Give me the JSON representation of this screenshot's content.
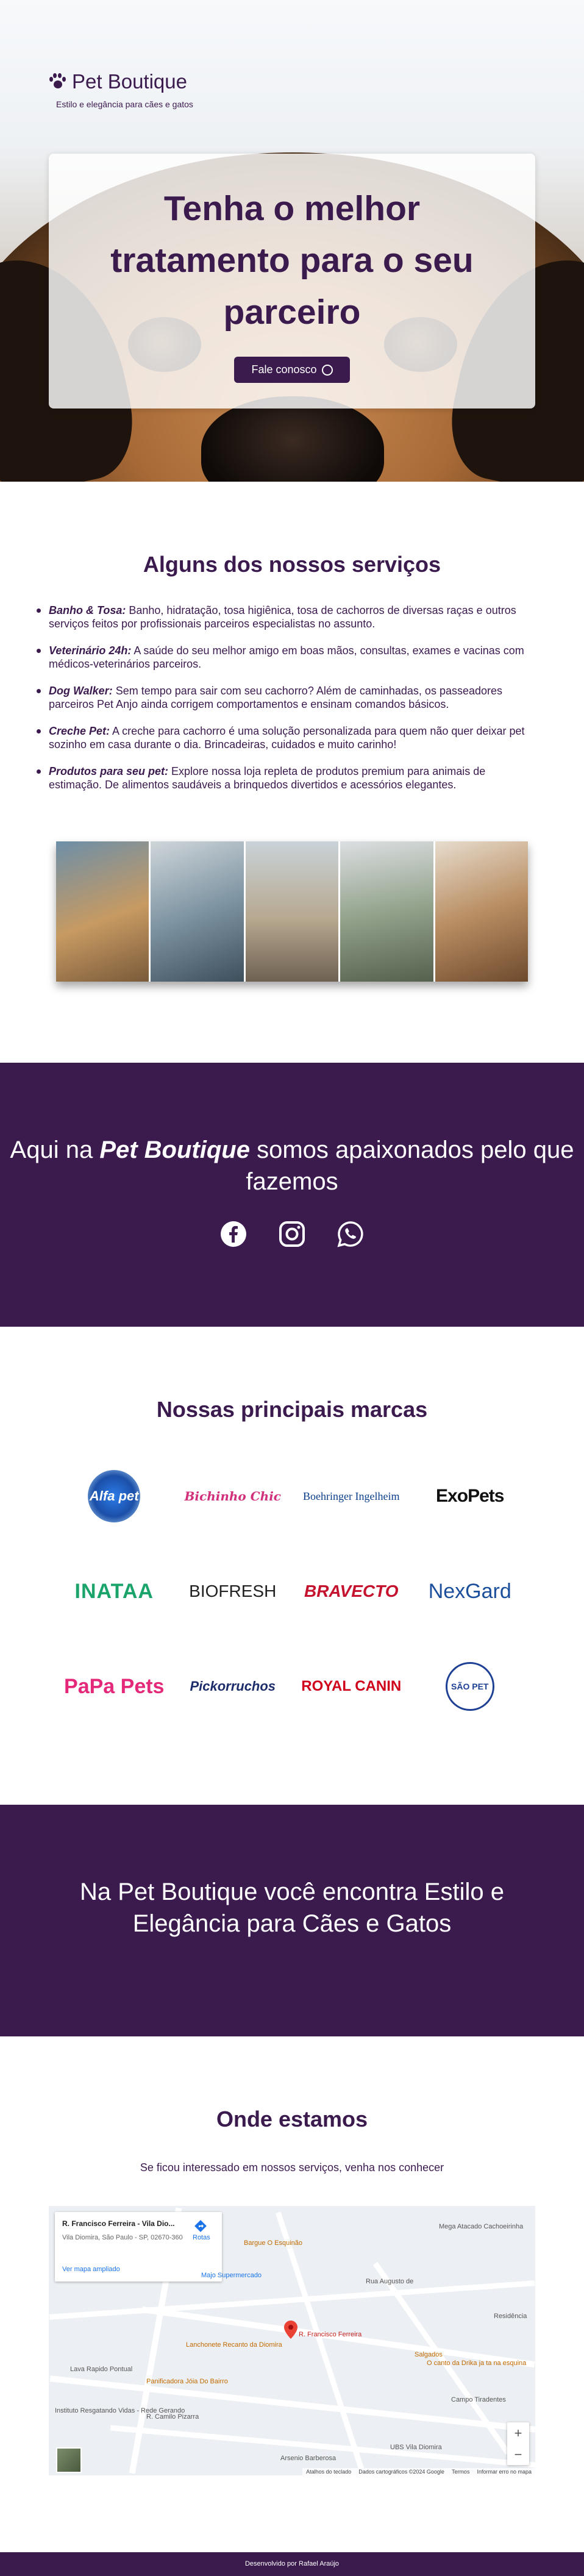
{
  "header": {
    "brand_name": "Pet Boutique",
    "tagline": "Estilo e elegância para cães e gatos"
  },
  "hero": {
    "title": "Tenha o melhor tratamento para o seu parceiro",
    "cta_label": "Fale conosco"
  },
  "services": {
    "title": "Alguns dos nossos serviços",
    "items": [
      {
        "name": "Banho & Tosa:",
        "desc": " Banho, hidratação, tosa higiênica, tosa de cachorros de diversas raças e outros serviços feitos por profissionais parceiros especialistas no assunto."
      },
      {
        "name": "Veterinário 24h:",
        "desc": " A saúde do seu melhor amigo em boas mãos, consultas, exames e vacinas com médicos-veterinários parceiros."
      },
      {
        "name": "Dog Walker:",
        "desc": " Sem tempo para sair com seu cachorro? Além de caminhadas, os passeadores parceiros Pet Anjo ainda corrigem comportamentos e ensinam comandos básicos."
      },
      {
        "name": "Creche Pet:",
        "desc": " A creche para cachorro é uma solução personalizada para quem não quer deixar pet sozinho em casa durante o dia. Brincadeiras, cuidados e muito carinho!"
      },
      {
        "name": "Produtos para seu pet:",
        "desc": " Explore nossa loja repleta de produtos premium para animais de estimação. De alimentos saudáveis a brinquedos divertidos e acessórios elegantes."
      }
    ]
  },
  "passion": {
    "text_before": "Aqui na ",
    "brand": "Pet Boutique",
    "text_after": " somos apaixonados pelo que fazemos"
  },
  "social": {
    "facebook_icon": "facebook-icon",
    "instagram_icon": "instagram-icon",
    "whatsapp_icon": "whatsapp-icon"
  },
  "brands": {
    "title": "Nossas principais marcas",
    "items": [
      {
        "name": "Alfa pet",
        "color": "#1f6fd8"
      },
      {
        "name": "Bichinho Chic",
        "color": "#d2307a"
      },
      {
        "name": "Boehringer Ingelheim",
        "color": "#0b3e8a"
      },
      {
        "name": "ExoPets",
        "color": "#111111"
      },
      {
        "name": "INATAA",
        "color": "#1aa36a"
      },
      {
        "name": "BIOFRESH",
        "color": "#222222"
      },
      {
        "name": "BRAVECTO",
        "color": "#c4122f"
      },
      {
        "name": "NexGard",
        "color": "#1b4f9c"
      },
      {
        "name": "PaPa Pets",
        "color": "#e5297a"
      },
      {
        "name": "Pickorruchos",
        "color": "#1d2d6b"
      },
      {
        "name": "ROYAL CANIN",
        "color": "#d0021b"
      },
      {
        "name": "SÃO PET",
        "color": "#1d3f94"
      }
    ]
  },
  "elegance": {
    "text": "Na Pet Boutique você encontra Estilo e Elegância para Cães e Gatos"
  },
  "location": {
    "title": "Onde estamos",
    "subtitle": "Se ficou interessado em nossos serviços, venha nos conhecer",
    "map_card": {
      "title": "R. Francisco Ferreira - Vila Dio...",
      "address": "Vila Diomira, São Paulo - SP, 02670-360",
      "directions": "Rotas",
      "larger_map": "Ver mapa ampliado"
    },
    "map_labels": [
      "Bargue O Esquinão",
      "Mega Atacado Cachoeirinha",
      "Majo Supermercado",
      "Rua Augusto de",
      "R. Francisco Ferreira",
      "Lanchonete Recanto da Diomira",
      "Lava Rapido Pontual",
      "Panificadora Jóia Do Bairro",
      "Salgados",
      "O canto da Drika ja ta na esquina",
      "Campo Tiradentes",
      "UBS Vila Diomira",
      "Instituto Resgatando Vidas - Rede Gerando",
      "R. Camilo Pizarra",
      "Arsenio Barberosa",
      "Residência"
    ],
    "attribution": [
      "Atalhos do teclado",
      "Dados cartográficos ©2024 Google",
      "Termos",
      "Informar erro no mapa"
    ],
    "zoom_in": "+",
    "zoom_out": "−"
  },
  "footer": {
    "text": "Desenvolvido por Rafael Araújo"
  }
}
